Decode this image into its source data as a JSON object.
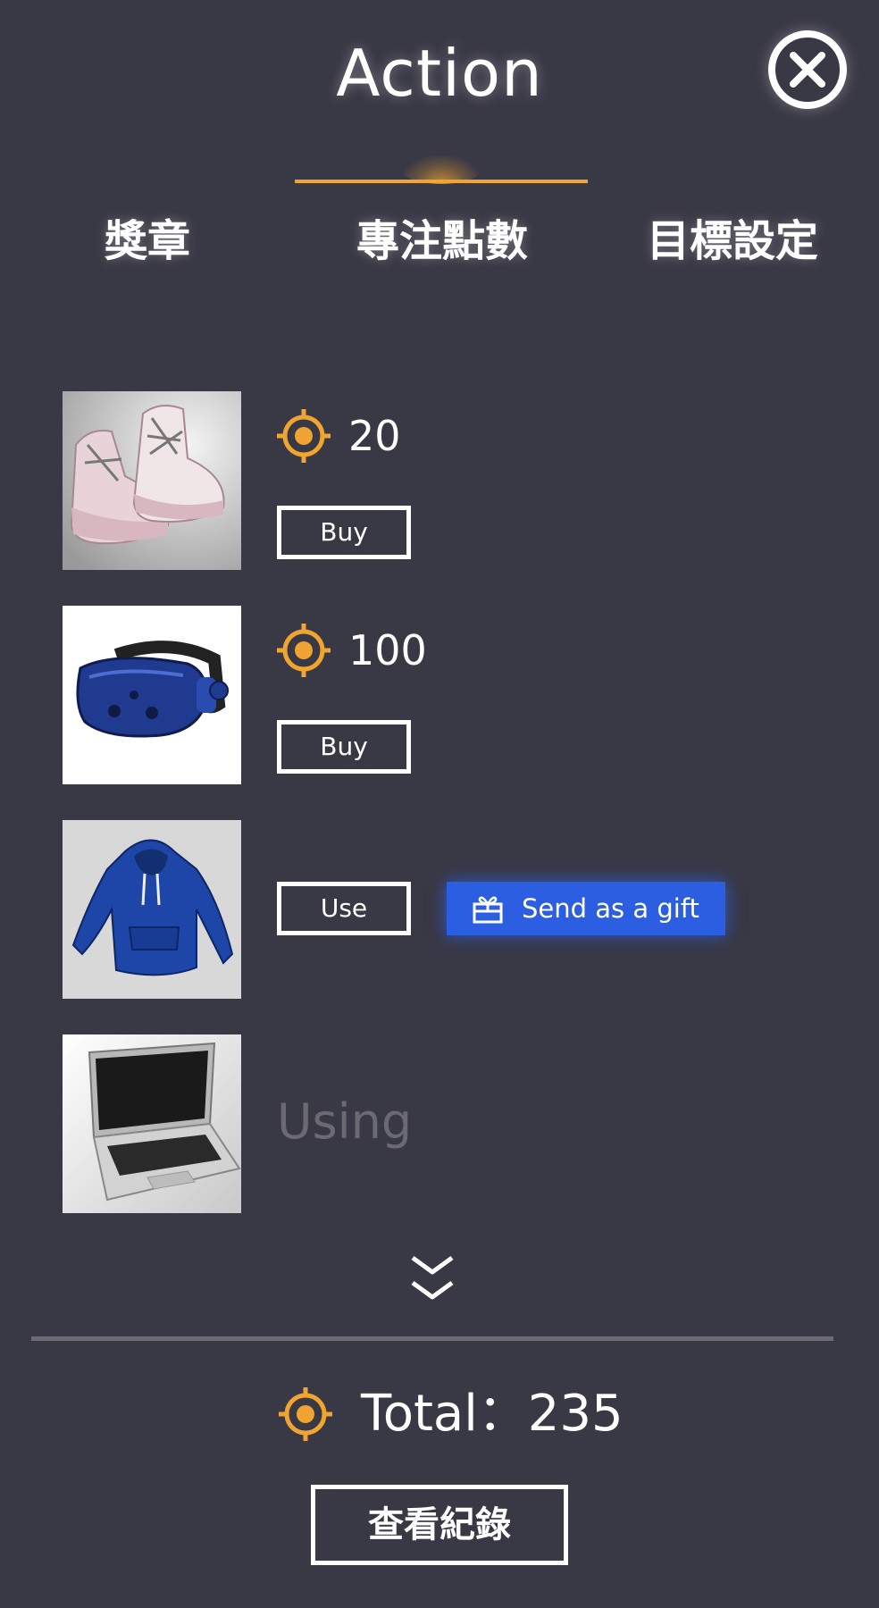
{
  "header": {
    "title": "Action",
    "close_icon": "close-circle-icon"
  },
  "tabs": [
    {
      "label": "獎章",
      "active": false
    },
    {
      "label": "專注點數",
      "active": true
    },
    {
      "label": "目標設定",
      "active": false
    }
  ],
  "colors": {
    "background": "#393845",
    "accent": "#f0a431",
    "gift_button": "#2b5ee0",
    "muted_text": "#6b6a72"
  },
  "items": [
    {
      "image": "sneakers-image",
      "price": "20",
      "action_label": "Buy"
    },
    {
      "image": "vr-headset-image",
      "price": "100",
      "action_label": "Buy"
    },
    {
      "image": "hoodie-image",
      "action_label": "Use",
      "gift_label": "Send as a gift",
      "gift_icon": "gift-icon"
    },
    {
      "image": "laptop-image",
      "status_label": "Using"
    }
  ],
  "footer": {
    "more_icon": "double-chevron-down-icon",
    "total_label": "Total：235",
    "total_icon": "target-icon",
    "history_button": "查看紀錄"
  }
}
